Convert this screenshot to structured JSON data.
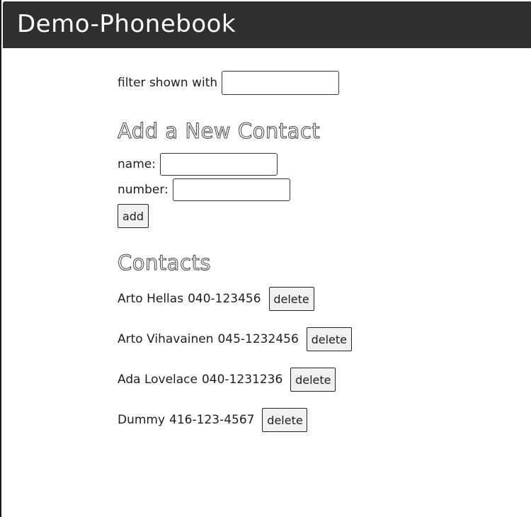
{
  "app": {
    "title": "Demo-Phonebook"
  },
  "filter": {
    "label": "filter shown with",
    "value": ""
  },
  "add_form": {
    "heading": "Add a New Contact",
    "name_label": "name:",
    "name_value": "",
    "number_label": "number:",
    "number_value": "",
    "add_label": "add"
  },
  "contacts": {
    "heading": "Contacts",
    "delete_label": "delete",
    "items": [
      {
        "name": "Arto Hellas",
        "number": "040-123456"
      },
      {
        "name": "Arto Vihavainen",
        "number": "045-1232456"
      },
      {
        "name": "Ada Lovelace",
        "number": "040-1231236"
      },
      {
        "name": "Dummy",
        "number": "416-123-4567"
      }
    ]
  },
  "colors": {
    "header_bg": "#2f2f2f",
    "header_text": "#ffffff",
    "button_bg": "#f0f0f0"
  }
}
